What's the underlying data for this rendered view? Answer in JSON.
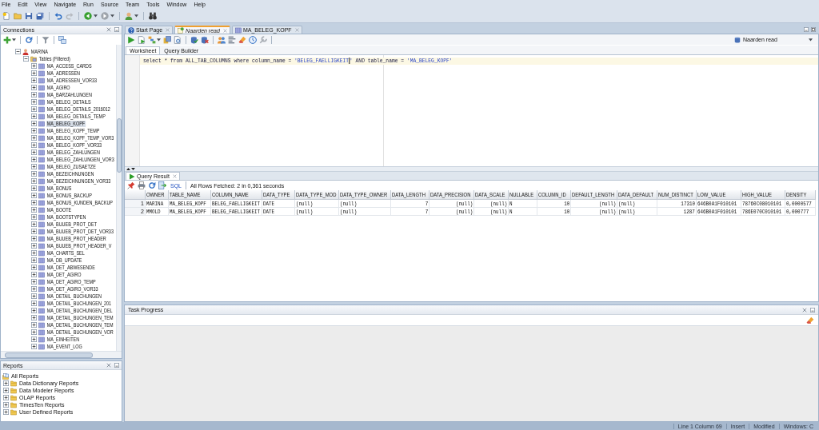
{
  "menu": [
    "File",
    "Edit",
    "View",
    "Navigate",
    "Run",
    "Source",
    "Team",
    "Tools",
    "Window",
    "Help"
  ],
  "connections": {
    "title": "Connections",
    "tree": [
      {
        "label": "MARINA",
        "kind": "user",
        "expanded": true,
        "selected": false,
        "children": [
          {
            "label": "Tables (Filtered)",
            "kind": "tables",
            "expanded": true,
            "selected": false,
            "children": [
              {
                "label": "MA_ACCESS_CARDS",
                "kind": "table",
                "expanded": false,
                "selected": false
              },
              {
                "label": "MA_ADRESSEN",
                "kind": "table",
                "expanded": false,
                "selected": false
              },
              {
                "label": "MA_ADRESSEN_VOR33",
                "kind": "table",
                "expanded": false,
                "selected": false
              },
              {
                "label": "MA_AGIRO",
                "kind": "table",
                "expanded": false,
                "selected": false
              },
              {
                "label": "MA_BARZAHLUNGEN",
                "kind": "table",
                "expanded": false,
                "selected": false
              },
              {
                "label": "MA_BELEG_DETAILS",
                "kind": "table",
                "expanded": false,
                "selected": false
              },
              {
                "label": "MA_BELEG_DETAILS_2016012",
                "kind": "table",
                "expanded": false,
                "selected": false
              },
              {
                "label": "MA_BELEG_DETAILS_TEMP",
                "kind": "table",
                "expanded": false,
                "selected": false
              },
              {
                "label": "MA_BELEG_KOPF",
                "kind": "table",
                "expanded": false,
                "selected": true
              },
              {
                "label": "MA_BELEG_KOPF_TEMP",
                "kind": "table",
                "expanded": false,
                "selected": false
              },
              {
                "label": "MA_BELEG_KOPF_TEMP_VOR3",
                "kind": "table",
                "expanded": false,
                "selected": false
              },
              {
                "label": "MA_BELEG_KOPF_VOR33",
                "kind": "table",
                "expanded": false,
                "selected": false
              },
              {
                "label": "MA_BELEG_ZAHLUNGEN",
                "kind": "table",
                "expanded": false,
                "selected": false
              },
              {
                "label": "MA_BELEG_ZAHLUNGEN_VOR3",
                "kind": "table",
                "expanded": false,
                "selected": false
              },
              {
                "label": "MA_BELEG_ZUSAETZE",
                "kind": "table",
                "expanded": false,
                "selected": false
              },
              {
                "label": "MA_BEZEICHNUNGEN",
                "kind": "table",
                "expanded": false,
                "selected": false
              },
              {
                "label": "MA_BEZEICHNUNGEN_VOR33",
                "kind": "table",
                "expanded": false,
                "selected": false
              },
              {
                "label": "MA_BONUS",
                "kind": "table",
                "expanded": false,
                "selected": false
              },
              {
                "label": "MA_BONUS_BACKUP",
                "kind": "table",
                "expanded": false,
                "selected": false
              },
              {
                "label": "MA_BONUS_KUNDEN_BACKUP",
                "kind": "table",
                "expanded": false,
                "selected": false
              },
              {
                "label": "MA_BOOTE",
                "kind": "table",
                "expanded": false,
                "selected": false
              },
              {
                "label": "MA_BOOTSTYPEN",
                "kind": "table",
                "expanded": false,
                "selected": false
              },
              {
                "label": "MA_BUUEB_PROT_DET",
                "kind": "table",
                "expanded": false,
                "selected": false
              },
              {
                "label": "MA_BUUEB_PROT_DET_VOR33",
                "kind": "table",
                "expanded": false,
                "selected": false
              },
              {
                "label": "MA_BUUEB_PROT_HEADER",
                "kind": "table",
                "expanded": false,
                "selected": false
              },
              {
                "label": "MA_BUUEB_PROT_HEADER_V",
                "kind": "table",
                "expanded": false,
                "selected": false
              },
              {
                "label": "MA_CHARTS_SEL",
                "kind": "table",
                "expanded": false,
                "selected": false
              },
              {
                "label": "MA_DB_UPDATE",
                "kind": "table",
                "expanded": false,
                "selected": false
              },
              {
                "label": "MA_DET_ABWESENDE",
                "kind": "table",
                "expanded": false,
                "selected": false
              },
              {
                "label": "MA_DET_AGIRO",
                "kind": "table",
                "expanded": false,
                "selected": false
              },
              {
                "label": "MA_DET_AGIRO_TEMP",
                "kind": "table",
                "expanded": false,
                "selected": false
              },
              {
                "label": "MA_DET_AGIRO_VOR33",
                "kind": "table",
                "expanded": false,
                "selected": false
              },
              {
                "label": "MA_DETAIL_BUCHUNGEN",
                "kind": "table",
                "expanded": false,
                "selected": false
              },
              {
                "label": "MA_DETAIL_BUCHUNGEN_201",
                "kind": "table",
                "expanded": false,
                "selected": false
              },
              {
                "label": "MA_DETAIL_BUCHUNGEN_DEL",
                "kind": "table",
                "expanded": false,
                "selected": false
              },
              {
                "label": "MA_DETAIL_BUCHUNGEN_TEM",
                "kind": "table",
                "expanded": false,
                "selected": false
              },
              {
                "label": "MA_DETAIL_BUCHUNGEN_TEM",
                "kind": "table",
                "expanded": false,
                "selected": false
              },
              {
                "label": "MA_DETAIL_BUCHUNGEN_VOR",
                "kind": "table",
                "expanded": false,
                "selected": false
              },
              {
                "label": "MA_EINHEITEN",
                "kind": "table",
                "expanded": false,
                "selected": false
              },
              {
                "label": "MA_EVENT_LOG",
                "kind": "table",
                "expanded": false,
                "selected": false
              }
            ]
          }
        ]
      }
    ]
  },
  "reports": {
    "title": "Reports",
    "tree": [
      {
        "label": "All Reports",
        "kind": "reports",
        "selected": false,
        "children": [
          {
            "label": "Data Dictionary Reports",
            "kind": "folder",
            "expanded": false,
            "selected": false
          },
          {
            "label": "Data Modeler Reports",
            "kind": "folder",
            "expanded": false,
            "selected": false
          },
          {
            "label": "OLAP Reports",
            "kind": "folder",
            "expanded": false,
            "selected": false
          },
          {
            "label": "TimesTen Reports",
            "kind": "folder",
            "expanded": false,
            "selected": false
          },
          {
            "label": "User Defined Reports",
            "kind": "folder",
            "expanded": false,
            "selected": false
          }
        ]
      }
    ]
  },
  "editor_tabs": [
    {
      "label": "Start Page",
      "kind": "start",
      "selected": false
    },
    {
      "label": "Naarden read",
      "kind": "worksheet",
      "selected": true
    },
    {
      "label": "MA_BELEG_KOPF",
      "kind": "table",
      "selected": false
    }
  ],
  "connection_selector": {
    "value": "Naarden read"
  },
  "worksheet_tabs": [
    {
      "label": "Worksheet",
      "selected": true
    },
    {
      "label": "Query Builder",
      "selected": false
    }
  ],
  "editor": {
    "lines": [
      {
        "current": true,
        "tokens": [
          {
            "kind": "plain",
            "text": "select * from ALL_TAB_COLUMNS where column_name = "
          },
          {
            "kind": "string",
            "text": "'BELEG_FAELLIGKEIT"
          },
          {
            "kind": "caret"
          },
          {
            "kind": "string",
            "text": "'"
          },
          {
            "kind": "plain",
            "text": " AND table_name = "
          },
          {
            "kind": "string",
            "text": "'MA_BELEG_KOPF'"
          }
        ]
      }
    ]
  },
  "result_tabs": [
    {
      "label": "Query Result",
      "selected": true
    }
  ],
  "result_toolbar": {
    "link": "SQL",
    "message": "All Rows Fetched: 2 in 0,361 seconds"
  },
  "result_grid": {
    "columns": [
      "OWNER",
      "TABLE_NAME",
      "COLUMN_NAME",
      "DATA_TYPE",
      "DATA_TYPE_MOD",
      "DATA_TYPE_OWNER",
      "DATA_LENGTH",
      "DATA_PRECISION",
      "DATA_SCALE",
      "NULLABLE",
      "COLUMN_ID",
      "DEFAULT_LENGTH",
      "DATA_DEFAULT",
      "NUM_DISTINCT",
      "LOW_VALUE",
      "HIGH_VALUE",
      "DENSITY"
    ],
    "rows": [
      {
        "number": "1",
        "cells": [
          "MARINA",
          "MA_BELEG_KOPF",
          "BELEG_FAELLIGKEIT",
          "DATE",
          "(null)",
          "(null)",
          "7",
          "(null)",
          "(null)",
          "N",
          "10",
          "(null)",
          "(null)",
          "17310",
          "646B0A1F010101",
          "78760C08010101",
          "0,0000577"
        ]
      },
      {
        "number": "2",
        "cells": [
          "MMOLD",
          "MA_BELEG_KOPF",
          "BELEG_FAELLIGKEIT",
          "DATE",
          "(null)",
          "(null)",
          "7",
          "(null)",
          "(null)",
          "N",
          "10",
          "(null)",
          "(null)",
          "1287",
          "646B0A1F010101",
          "786E070C010101",
          "0,000777"
        ]
      }
    ]
  },
  "task_progress": {
    "title": "Task Progress"
  },
  "status_bar": [
    "Line 1 Column 69",
    "Insert",
    "Modified",
    "Windows: C"
  ]
}
